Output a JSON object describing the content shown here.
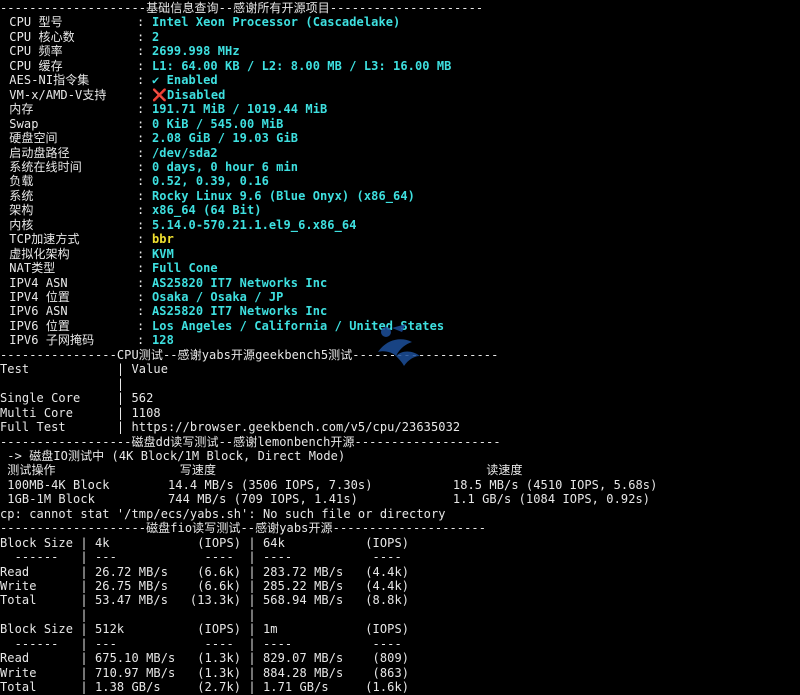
{
  "basic_info": {
    "header": "--------------------基础信息查询--感谢所有开源项目---------------------",
    "rows": [
      {
        "label": " CPU 型号",
        "value": "Intel Xeon Processor (Cascadelake)"
      },
      {
        "label": " CPU 核心数",
        "value": "2"
      },
      {
        "label": " CPU 频率",
        "value": "2699.998 MHz"
      },
      {
        "label": " CPU 缓存",
        "value": "L1: 64.00 KB / L2: 8.00 MB / L3: 16.00 MB"
      },
      {
        "label": " AES-NI指令集",
        "value": "✔ Enabled"
      },
      {
        "label": " VM-x/AMD-V支持",
        "value": "❌Disabled"
      },
      {
        "label": " 内存",
        "value": "191.71 MiB / 1019.44 MiB"
      },
      {
        "label": " Swap",
        "value": "0 KiB / 545.00 MiB"
      },
      {
        "label": " 硬盘空间",
        "value": "2.08 GiB / 19.03 GiB"
      },
      {
        "label": " 启动盘路径",
        "value": "/dev/sda2"
      },
      {
        "label": " 系统在线时间",
        "value": "0 days, 0 hour 6 min"
      },
      {
        "label": " 负载",
        "value": "0.52, 0.39, 0.16"
      },
      {
        "label": " 系统",
        "value": "Rocky Linux 9.6 (Blue Onyx) (x86_64)"
      },
      {
        "label": " 架构",
        "value": "x86_64 (64 Bit)"
      },
      {
        "label": " 内核",
        "value": "5.14.0-570.21.1.el9_6.x86_64"
      },
      {
        "label": " TCP加速方式",
        "value": "bbr",
        "color": "yellow"
      },
      {
        "label": " 虚拟化架构",
        "value": "KVM"
      },
      {
        "label": " NAT类型",
        "value": "Full Cone"
      },
      {
        "label": " IPV4 ASN",
        "value": "AS25820 IT7 Networks Inc"
      },
      {
        "label": " IPV4 位置",
        "value": "Osaka / Osaka / JP"
      },
      {
        "label": " IPV6 ASN",
        "value": "AS25820 IT7 Networks Inc"
      },
      {
        "label": " IPV6 位置",
        "value": "Los Angeles / California / United States"
      },
      {
        "label": " IPV6 子网掩码",
        "value": "128"
      }
    ]
  },
  "cpu_test": {
    "header": "----------------CPU测试--感谢yabs开源geekbench5测试--------------------",
    "lines": [
      "Test            | Value",
      "                |",
      "Single Core     | 562",
      "Multi Core      | 1108",
      "Full Test       | https://browser.geekbench.com/v5/cpu/23635032"
    ]
  },
  "dd_test": {
    "header": "------------------磁盘dd读写测试--感谢lemonbench开源--------------------",
    "lines": [
      " -> 磁盘IO测试中 (4K Block/1M Block, Direct Mode)",
      " 测试操作                 写速度                                     读速度",
      " 100MB-4K Block        14.4 MB/s (3506 IOPS, 7.30s)           18.5 MB/s (4510 IOPS, 5.68s)",
      " 1GB-1M Block          744 MB/s (709 IOPS, 1.41s)             1.1 GB/s (1084 IOPS, 0.92s)",
      "cp: cannot stat '/tmp/ecs/yabs.sh': No such file or directory"
    ]
  },
  "fio_test": {
    "header": "--------------------磁盘fio读写测试--感谢yabs开源---------------------",
    "lines": [
      "Block Size | 4k            (IOPS) | 64k           (IOPS)",
      "  ------   | ---            ----  | ----           ----",
      "Read       | 26.72 MB/s    (6.6k) | 283.72 MB/s   (4.4k)",
      "Write      | 26.75 MB/s    (6.6k) | 285.22 MB/s   (4.4k)",
      "Total      | 53.47 MB/s   (13.3k) | 568.94 MB/s   (8.8k)",
      "           |                      |",
      "Block Size | 512k          (IOPS) | 1m            (IOPS)",
      "  ------   | ---            ----  | ----           ----",
      "Read       | 675.10 MB/s   (1.3k) | 829.07 MB/s    (809)",
      "Write      | 710.97 MB/s   (1.3k) | 884.28 MB/s    (863)",
      "Total      | 1.38 GB/s     (2.7k) | 1.71 GB/s     (1.6k)"
    ]
  },
  "colors": {
    "background": "#000000",
    "value_cyan": "#3ee0e0",
    "value_yellow": "#f0e030",
    "text": "#e8e8e8"
  },
  "watermark_icon": "bird-logo-icon"
}
